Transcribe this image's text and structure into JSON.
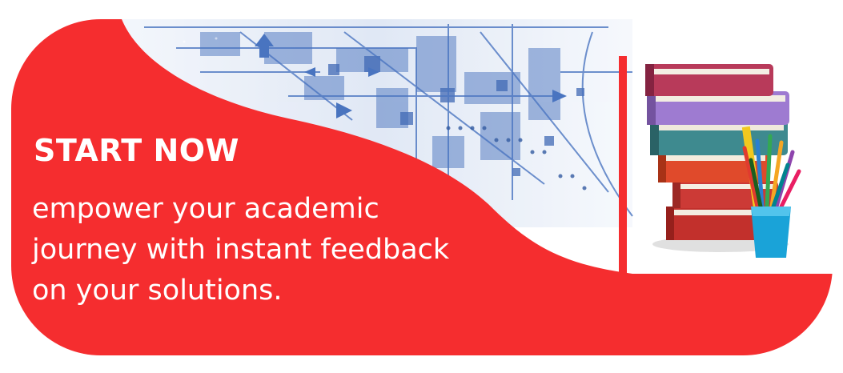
{
  "banner": {
    "cta_label": "START NOW",
    "tagline_lines": [
      "empower your academic",
      "journey with instant feedback",
      "on your solutions."
    ]
  },
  "colors": {
    "primary_red": "#f52d2f",
    "card_white": "#ffffff",
    "tech_blue": "#1f4fa8"
  },
  "icons": [
    "tech-circuit-graphic",
    "books-stack-icon",
    "pencil-cup-icon"
  ]
}
